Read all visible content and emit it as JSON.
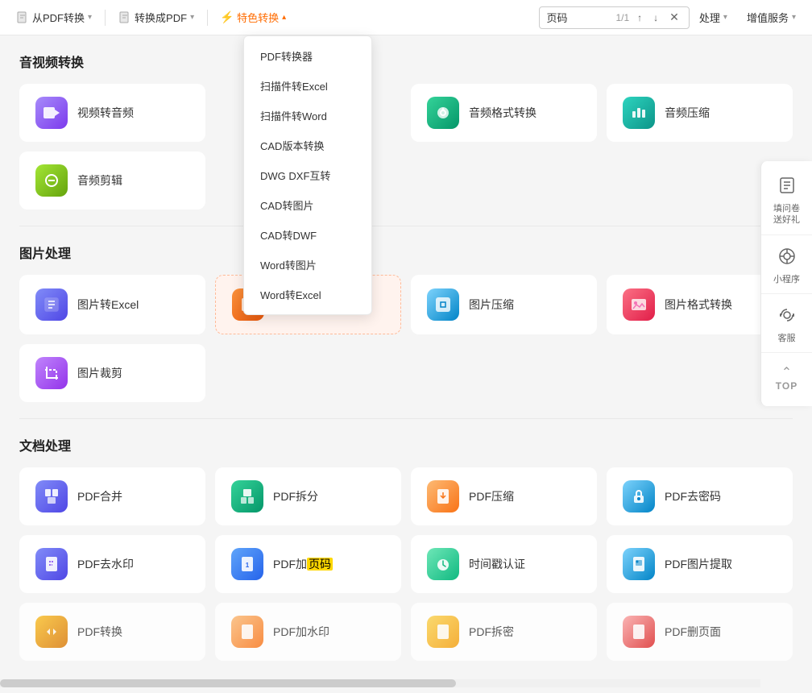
{
  "toolbar": {
    "items": [
      {
        "label": "从PDF转换",
        "id": "from-pdf",
        "active": false
      },
      {
        "label": "转换成PDF",
        "id": "to-pdf",
        "active": false
      },
      {
        "label": "特色转换",
        "id": "special",
        "active": true
      },
      {
        "label": "处理",
        "id": "process",
        "active": false
      },
      {
        "label": "增值服务",
        "id": "vip",
        "active": false
      }
    ],
    "search": {
      "placeholder": "页码",
      "value": "页码",
      "page_current": "1",
      "page_total": "1"
    }
  },
  "dropdown": {
    "items": [
      {
        "label": "PDF转换器",
        "id": "pdf-converter"
      },
      {
        "label": "扫描件转Excel",
        "id": "scan-excel"
      },
      {
        "label": "扫描件转Word",
        "id": "scan-word"
      },
      {
        "label": "CAD版本转换",
        "id": "cad-version"
      },
      {
        "label": "DWG DXF互转",
        "id": "dwg-dxf"
      },
      {
        "label": "CAD转图片",
        "id": "cad-image"
      },
      {
        "label": "CAD转DWF",
        "id": "cad-dwf"
      },
      {
        "label": "Word转图片",
        "id": "word-image"
      },
      {
        "label": "Word转Excel",
        "id": "word-excel"
      }
    ]
  },
  "sections": [
    {
      "id": "audio-video",
      "title": "音视频转换",
      "tools": [
        {
          "name": "视频转音频",
          "icon": "🎬",
          "color": "icon-purple",
          "id": "video-audio"
        },
        {
          "name": "",
          "icon": "📄",
          "color": "icon-blue",
          "id": "placeholder1"
        },
        {
          "name": "音频格式转换",
          "icon": "🎵",
          "color": "icon-green",
          "id": "audio-format"
        },
        {
          "name": "音频压缩",
          "icon": "🎼",
          "color": "icon-teal",
          "id": "audio-compress"
        },
        {
          "name": "音频剪辑",
          "icon": "✂️",
          "color": "icon-lime",
          "id": "audio-edit"
        }
      ]
    },
    {
      "id": "image-processing",
      "title": "图片处理",
      "tools": [
        {
          "name": "图片转Excel",
          "icon": "📊",
          "color": "icon-indigo",
          "id": "image-excel"
        },
        {
          "name": "",
          "icon": "📋",
          "color": "icon-orange",
          "id": "placeholder2"
        },
        {
          "name": "图片压缩",
          "icon": "🖼️",
          "color": "icon-sky",
          "id": "image-compress"
        },
        {
          "name": "图片格式转换",
          "icon": "🖼️",
          "color": "icon-rose",
          "id": "image-format"
        },
        {
          "name": "图片裁剪",
          "icon": "✂️",
          "color": "icon-violet",
          "id": "image-crop"
        }
      ]
    },
    {
      "id": "doc-processing",
      "title": "文档处理",
      "tools": [
        {
          "name": "PDF合并",
          "icon": "📑",
          "color": "icon-indigo",
          "id": "pdf-merge"
        },
        {
          "name": "PDF拆分",
          "icon": "📋",
          "color": "icon-green",
          "id": "pdf-split"
        },
        {
          "name": "PDF压缩",
          "icon": "📦",
          "color": "icon-peach",
          "id": "pdf-compress"
        },
        {
          "name": "PDF去密码",
          "icon": "🔓",
          "color": "icon-sky",
          "id": "pdf-decrypt"
        },
        {
          "name": "PDF去水印",
          "icon": "💧",
          "color": "icon-indigo",
          "id": "pdf-watermark"
        },
        {
          "name": "PDF加页码",
          "icon": "📄",
          "color": "icon-blue",
          "id": "pdf-page"
        },
        {
          "name": "时间戳认证",
          "icon": "⏱️",
          "color": "icon-emerald",
          "id": "timestamp"
        },
        {
          "name": "PDF图片提取",
          "icon": "🖼️",
          "color": "icon-sky",
          "id": "pdf-image"
        },
        {
          "name": "PDF转换",
          "icon": "🔄",
          "color": "icon-yellow",
          "id": "pdf-convert2"
        },
        {
          "name": "PDF加水印",
          "icon": "💦",
          "color": "icon-peach",
          "id": "pdf-add-watermark"
        },
        {
          "name": "PDF拆密",
          "icon": "🔑",
          "color": "icon-amber",
          "id": "pdf-crack"
        },
        {
          "name": "PDF删页面",
          "icon": "🗑️",
          "color": "icon-red",
          "id": "pdf-delete"
        }
      ]
    }
  ],
  "right_sidebar": {
    "widgets": [
      {
        "label": "填问卷\n送好礼",
        "icon": "📋",
        "id": "survey"
      },
      {
        "label": "小程序",
        "icon": "⊙",
        "id": "miniapp"
      },
      {
        "label": "客服",
        "icon": "🎧",
        "id": "support"
      }
    ],
    "top_label": "TOP"
  }
}
